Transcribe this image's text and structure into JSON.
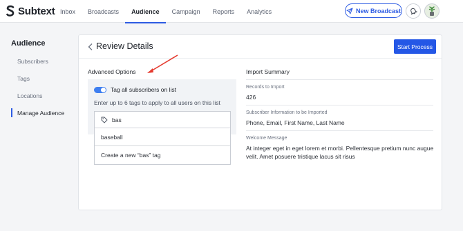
{
  "brand": {
    "name": "Subtext",
    "accent": "#2d5be3"
  },
  "nav": {
    "items": [
      {
        "label": "Inbox",
        "active": false
      },
      {
        "label": "Broadcasts",
        "active": false
      },
      {
        "label": "Audience",
        "active": true
      },
      {
        "label": "Campaign",
        "active": false
      },
      {
        "label": "Reports",
        "active": false
      },
      {
        "label": "Analytics",
        "active": false
      }
    ],
    "new_broadcast_label": "New Broadcast",
    "icons": [
      "send-icon",
      "bell-icon",
      "avatar"
    ]
  },
  "sidebar": {
    "title": "Audience",
    "items": [
      {
        "label": "Subscribers",
        "active": false
      },
      {
        "label": "Tags",
        "active": false
      },
      {
        "label": "Locations",
        "active": false
      },
      {
        "label": "Manage Audience",
        "active": true
      }
    ]
  },
  "review": {
    "title": "Review Details",
    "start_label": "Start Process",
    "advanced": {
      "title": "Advanced Options",
      "toggle_label": "Tag all subscribers on list",
      "toggle_on": true,
      "hint": "Enter up to 6 tags to apply to all users on this list",
      "tag_input_value": "bas",
      "suggestions": [
        "baseball",
        "Create a new “bas” tag"
      ]
    },
    "summary": {
      "title": "Import Summary",
      "fields": [
        {
          "label": "Records to Import",
          "value": "426"
        },
        {
          "label": "Subscriber Information to be Imported",
          "value": "Phone, Email, First Name, Last Name"
        },
        {
          "label": "Welcome Message",
          "value": "At integer eget in eget lorem et morbi. Pellentesque pretium nunc augue velit. Amet posuere tristique lacus sit risus"
        }
      ]
    }
  },
  "annotation_color": "#e53a2f"
}
